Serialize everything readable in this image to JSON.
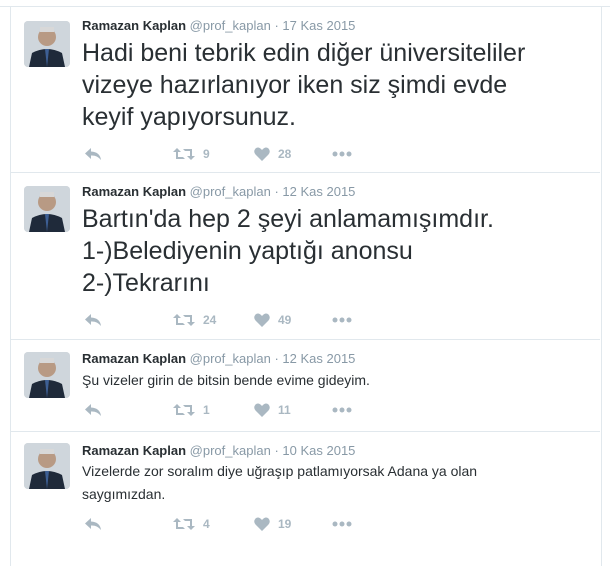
{
  "tweets": [
    {
      "name": "Ramazan Kaplan",
      "handle": "@prof_kaplan",
      "sep": "·",
      "date": "17 Kas 2015",
      "text_lines": [
        "Hadi beni tebrik edin diğer üniversiteliler",
        "vizeye hazırlanıyor iken siz şimdi evde",
        "keyif yapıyorsunuz."
      ],
      "retweets": "9",
      "likes": "28"
    },
    {
      "name": "Ramazan Kaplan",
      "handle": "@prof_kaplan",
      "sep": "·",
      "date": "12 Kas 2015",
      "text_lines": [
        "Bartın'da hep 2 şeyi anlamamışımdır.",
        "1-)Belediyenin yaptığı anonsu",
        "2-)Tekrarını"
      ],
      "retweets": "24",
      "likes": "49"
    },
    {
      "name": "Ramazan Kaplan",
      "handle": "@prof_kaplan",
      "sep": "·",
      "date": "12 Kas 2015",
      "text_lines": [
        "Şu vizeler girin de bitsin bende evime gideyim."
      ],
      "retweets": "1",
      "likes": "11"
    },
    {
      "name": "Ramazan Kaplan",
      "handle": "@prof_kaplan",
      "sep": "·",
      "date": "10 Kas 2015",
      "text_lines": [
        "Vizelerde zor soralım diye uğraşıp patlamıyorsak Adana ya olan",
        "saygımızdan."
      ],
      "retweets": "4",
      "likes": "19"
    }
  ],
  "icons": {
    "reply": "reply-icon",
    "retweet": "retweet-icon",
    "like": "heart-icon",
    "more": "more-icon"
  },
  "colors": {
    "text": "#292f33",
    "meta": "#8899a6",
    "icon": "#aab8c2",
    "border": "#e1e8ed"
  }
}
